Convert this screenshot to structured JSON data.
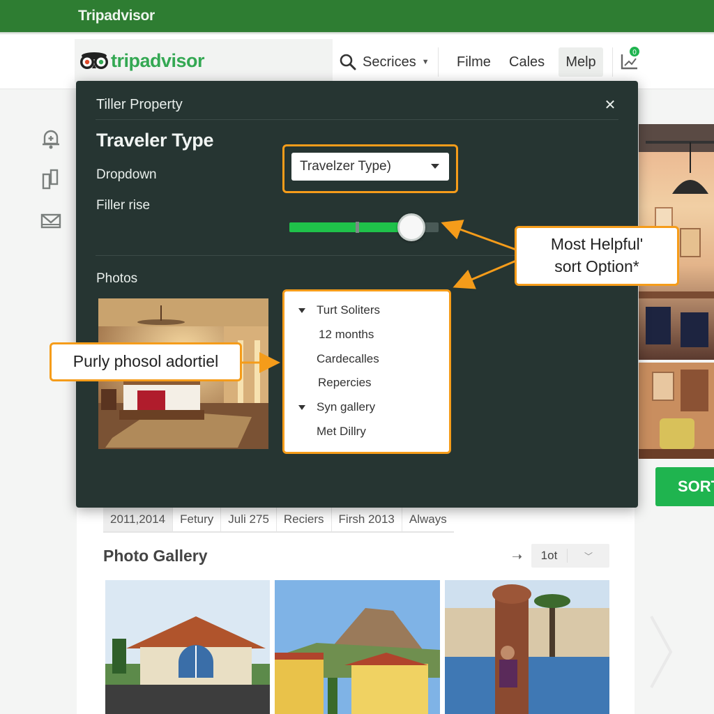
{
  "window": {
    "title": "Tripadvisor"
  },
  "nav": {
    "logo_text": "tripadvisor",
    "search_label": "Secrices",
    "links": [
      "Filme",
      "Cales"
    ],
    "help_label": "Melp",
    "notification_count": "0"
  },
  "modal": {
    "title": "Tiller Property",
    "section_title": "Traveler Type",
    "dropdown_label": "Dropdown",
    "dropdown_value": "Travelzer Type)",
    "slider_label": "Filler rise",
    "slider_value": 0.82,
    "photos_label": "Photos",
    "list_items": [
      {
        "label": "Turt Soliters",
        "bullet": true
      },
      {
        "label": "12 months",
        "bullet": false
      },
      {
        "label": "Cardecalles",
        "bullet": false
      },
      {
        "label": "Repercies",
        "bullet": false
      },
      {
        "label": "Syn gallery",
        "bullet": true
      },
      {
        "label": "Met Dillry",
        "bullet": false
      }
    ]
  },
  "callouts": {
    "sort_option": "Most Helpful'\nsort Option*",
    "photo_ad": "Purly phosol adortiel"
  },
  "sort_button_label": "SORT",
  "tabs": [
    "2011,2014",
    "Fetury",
    "Juli 275",
    "Reciers",
    "Firsh 2013",
    "Always"
  ],
  "gallery": {
    "title": "Photo Gallery",
    "select_value": "1ot"
  },
  "colors": {
    "brand_green": "#2e7d32",
    "logo_green": "#34a853",
    "accent_orange": "#f59c1a",
    "modal_bg": "#263532",
    "slider_fill": "#1fc24a",
    "sort_button": "#1fb44f"
  }
}
